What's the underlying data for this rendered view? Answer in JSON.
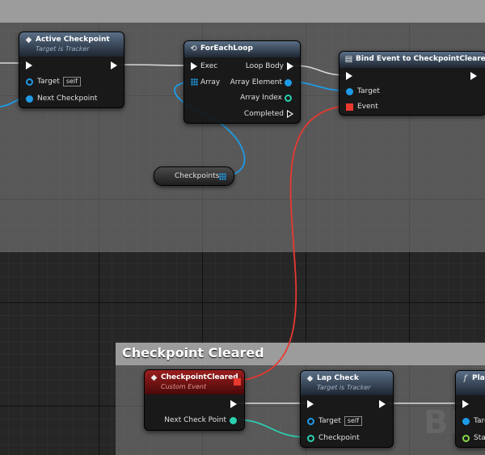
{
  "comments": {
    "main_graph": {
      "title": ""
    },
    "checkpoint_cleared": {
      "title": "Checkpoint Cleared"
    }
  },
  "nodes": {
    "active_checkpoint": {
      "title": "Active Checkpoint",
      "subtitle": "Target is Tracker",
      "pin_target": "Target",
      "self_label": "self",
      "pin_next": "Next Checkpoint"
    },
    "foreach": {
      "title": "ForEachLoop",
      "pin_exec": "Exec",
      "pin_loop_body": "Loop Body",
      "pin_array": "Array",
      "pin_array_element": "Array Element",
      "pin_array_index": "Array Index",
      "pin_completed": "Completed"
    },
    "bind_event": {
      "title": "Bind Event to CheckpointCleared",
      "pin_target": "Target",
      "pin_event": "Event"
    },
    "checkpoints_var": {
      "label": "Checkpoints"
    },
    "checkpoint_cleared_event": {
      "title": "CheckpointCleared",
      "subtitle": "Custom Event",
      "pin_next": "Next Check Point"
    },
    "lap_check": {
      "title": "Lap Check",
      "subtitle": "Target is Tracker",
      "pin_target": "Target",
      "self_label": "self",
      "pin_checkpoint": "Checkpoint"
    },
    "play_node": {
      "title": "Play",
      "pin_target": "Targ",
      "pin_start": "Star"
    }
  },
  "watermark": "BL",
  "colors": {
    "exec": "#ffffff",
    "object_pin": "#1e9be8",
    "struct_pin": "#2ad1b0",
    "delegate_pin": "#e8382f",
    "bool_pin": "#8bd84a",
    "event_header": "#9a1e1e"
  }
}
